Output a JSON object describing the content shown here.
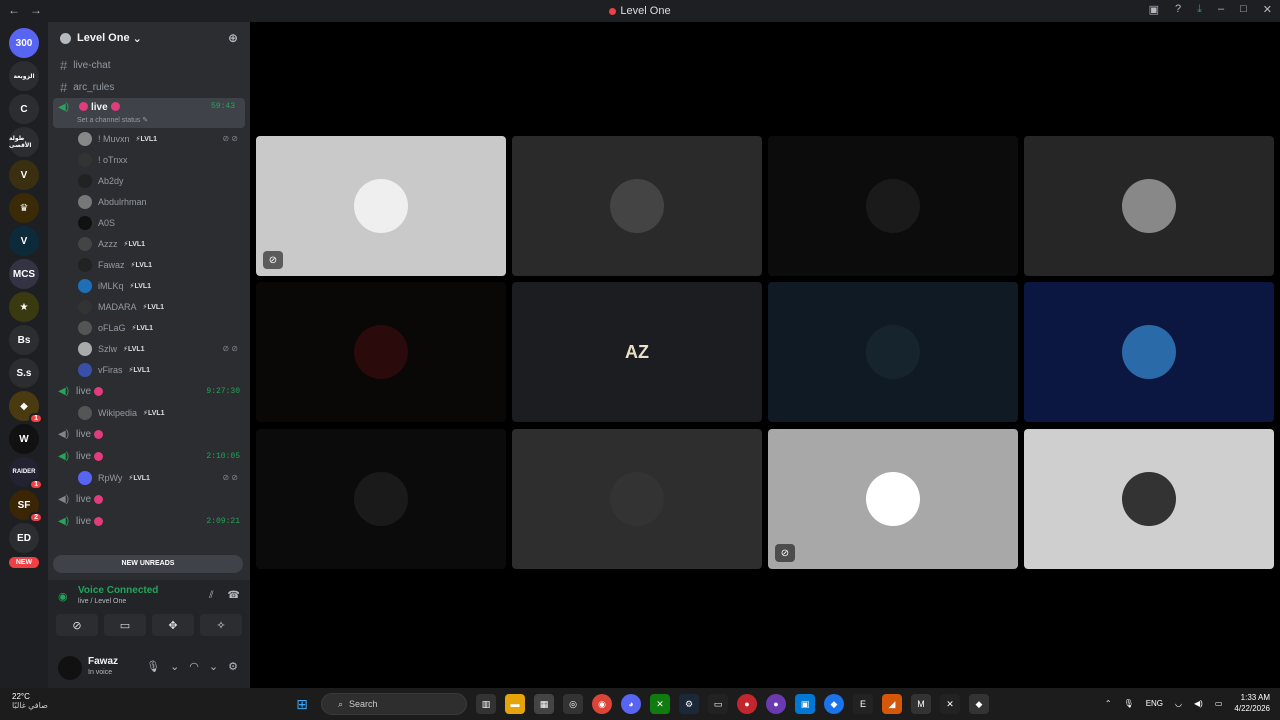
{
  "window": {
    "title": "Level One"
  },
  "servers": [
    {
      "label": "300",
      "color": "#5865f2",
      "badge": ""
    },
    {
      "label": "الزوبعة",
      "color": "#2b2d31",
      "badge": ""
    },
    {
      "label": "C",
      "color": "#2b2d31",
      "badge": ""
    },
    {
      "label": "طولة الأقصى",
      "color": "#2b2d31",
      "badge": ""
    },
    {
      "label": "V",
      "color": "#3a2f10",
      "badge": ""
    },
    {
      "label": "♛",
      "color": "#3a2a05",
      "badge": ""
    },
    {
      "label": "V",
      "color": "#0c2a3a",
      "badge": ""
    },
    {
      "label": "MCS",
      "color": "#334",
      "badge": ""
    },
    {
      "label": "★",
      "color": "#3a3a10",
      "badge": ""
    },
    {
      "label": "Bs",
      "color": "#2b2d31",
      "badge": ""
    },
    {
      "label": "S.s",
      "color": "#2b2d31",
      "badge": ""
    },
    {
      "label": "◆",
      "color": "#4a3a10",
      "badge": "1"
    },
    {
      "label": "W",
      "color": "#111",
      "badge": ""
    },
    {
      "label": "RAIDER",
      "color": "#223",
      "badge": "1"
    },
    {
      "label": "SF",
      "color": "#3a2505",
      "badge": "2"
    },
    {
      "label": "ED",
      "color": "#2b2d31",
      "badge": ""
    }
  ],
  "server_new_label": "NEW",
  "guild": {
    "name": "Level One"
  },
  "channels": {
    "text": [
      "live-chat",
      "arc_rules"
    ],
    "active_voice": {
      "name": "live",
      "time": "59:43",
      "status_hint": "Set a channel status"
    },
    "members": [
      {
        "name": "! Muvxn",
        "tag": "LVL1",
        "icons": "⊘ ⊘"
      },
      {
        "name": "! oTnxx",
        "tag": "",
        "icons": ""
      },
      {
        "name": "Ab2dy",
        "tag": "",
        "icons": ""
      },
      {
        "name": "Abdulrhman",
        "tag": "",
        "icons": ""
      },
      {
        "name": "A0S",
        "tag": "",
        "icons": ""
      },
      {
        "name": "Azzz",
        "tag": "LVL1",
        "icons": ""
      },
      {
        "name": "Fawaz",
        "tag": "LVL1",
        "icons": ""
      },
      {
        "name": "iMLKq",
        "tag": "LVL1",
        "icons": ""
      },
      {
        "name": "MADARA",
        "tag": "LVL1",
        "icons": ""
      },
      {
        "name": "oFLaG",
        "tag": "LVL1",
        "icons": ""
      },
      {
        "name": "Szlw",
        "tag": "LVL1",
        "icons": "⊘ ⊘"
      },
      {
        "name": "vFiras",
        "tag": "LVL1",
        "icons": ""
      }
    ],
    "voice_2": {
      "name": "live",
      "time": "9:27:30"
    },
    "voice_2_member": {
      "name": "Wikipedia",
      "tag": "LVL1"
    },
    "voice_3": {
      "name": "live",
      "time": ""
    },
    "voice_4": {
      "name": "live",
      "time": "2:10:05"
    },
    "voice_4_member": {
      "name": "RpWy",
      "tag": "LVL1",
      "icons": "⊘ ⊘"
    },
    "voice_5": {
      "name": "live",
      "time": ""
    },
    "voice_6": {
      "name": "live",
      "time": "2:09:21"
    },
    "new_unreads": "NEW UNREADS"
  },
  "voice_panel": {
    "connected": "Voice Connected",
    "location": "live / Level One"
  },
  "user": {
    "name": "Fawaz",
    "status": "In voice"
  },
  "tiles": [
    {
      "bg": "#c9c9c9",
      "pic": "#efefef",
      "muted": true
    },
    {
      "bg": "#2a2a2a",
      "pic": "#444",
      "muted": false
    },
    {
      "bg": "#0c0c0c",
      "pic": "#1a1a1a",
      "muted": false
    },
    {
      "bg": "#262626",
      "pic": "#888",
      "muted": false
    },
    {
      "bg": "#0a0806",
      "pic": "#2a0a0a",
      "muted": false
    },
    {
      "bg": "#1c1d21",
      "pic": "#1c1d21",
      "muted": false,
      "text": "AZ"
    },
    {
      "bg": "#0f1a24",
      "pic": "#16242e",
      "muted": false
    },
    {
      "bg": "#0b1740",
      "pic": "#2a6aa8",
      "muted": false
    },
    {
      "bg": "#0b0b0b",
      "pic": "#1a1a1a",
      "muted": false
    },
    {
      "bg": "#2e2e2e",
      "pic": "#333",
      "muted": false
    },
    {
      "bg": "#a8a8a8",
      "pic": "#fff",
      "muted": true
    },
    {
      "bg": "#cfcfcf",
      "pic": "#333",
      "muted": false
    }
  ],
  "taskbar": {
    "temp": "22°C",
    "weather": "صافي غالبًا",
    "search": "Search",
    "lang": "ENG",
    "time": "1:33 AM",
    "date": "4/22/2026"
  }
}
